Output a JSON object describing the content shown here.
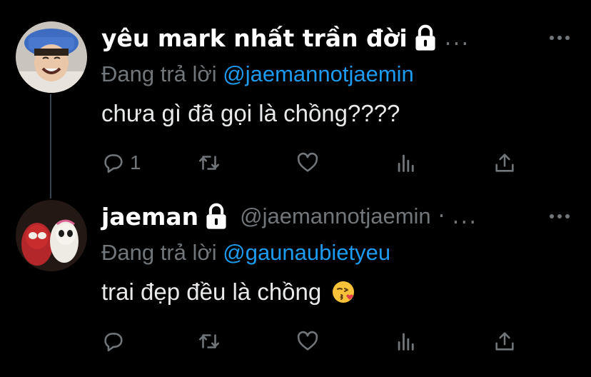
{
  "colors": {
    "background": "#000000",
    "text": "#e7e9ea",
    "secondary": "#71767b",
    "accent": "#1d9bf0",
    "thread_line": "#38444d"
  },
  "tweets": [
    {
      "display_name": "yêu mark nhất trần đời",
      "protected_icon": "lock-icon",
      "overflow_dots": "...",
      "reply_prefix": "Đang trả lời ",
      "reply_mention": "@jaemannotjaemin",
      "text": "chưa gì đã gọi là chồng????",
      "reply_count": "1",
      "icons": [
        "reply-icon",
        "retweet-icon",
        "like-icon",
        "views-icon",
        "share-icon"
      ]
    },
    {
      "display_name": "jaeman",
      "protected_icon": "lock-icon",
      "handle": "@jaemannotjaemin",
      "dot_separator": "·",
      "overflow_dots": "...",
      "reply_prefix": "Đang trả lời ",
      "reply_mention": "@gaunaubietyeu",
      "text": "trai đẹp đều là chồng",
      "emoji": "kissing-heart-emoji",
      "reply_count": "",
      "icons": [
        "reply-icon",
        "retweet-icon",
        "like-icon",
        "views-icon",
        "share-icon"
      ]
    }
  ]
}
